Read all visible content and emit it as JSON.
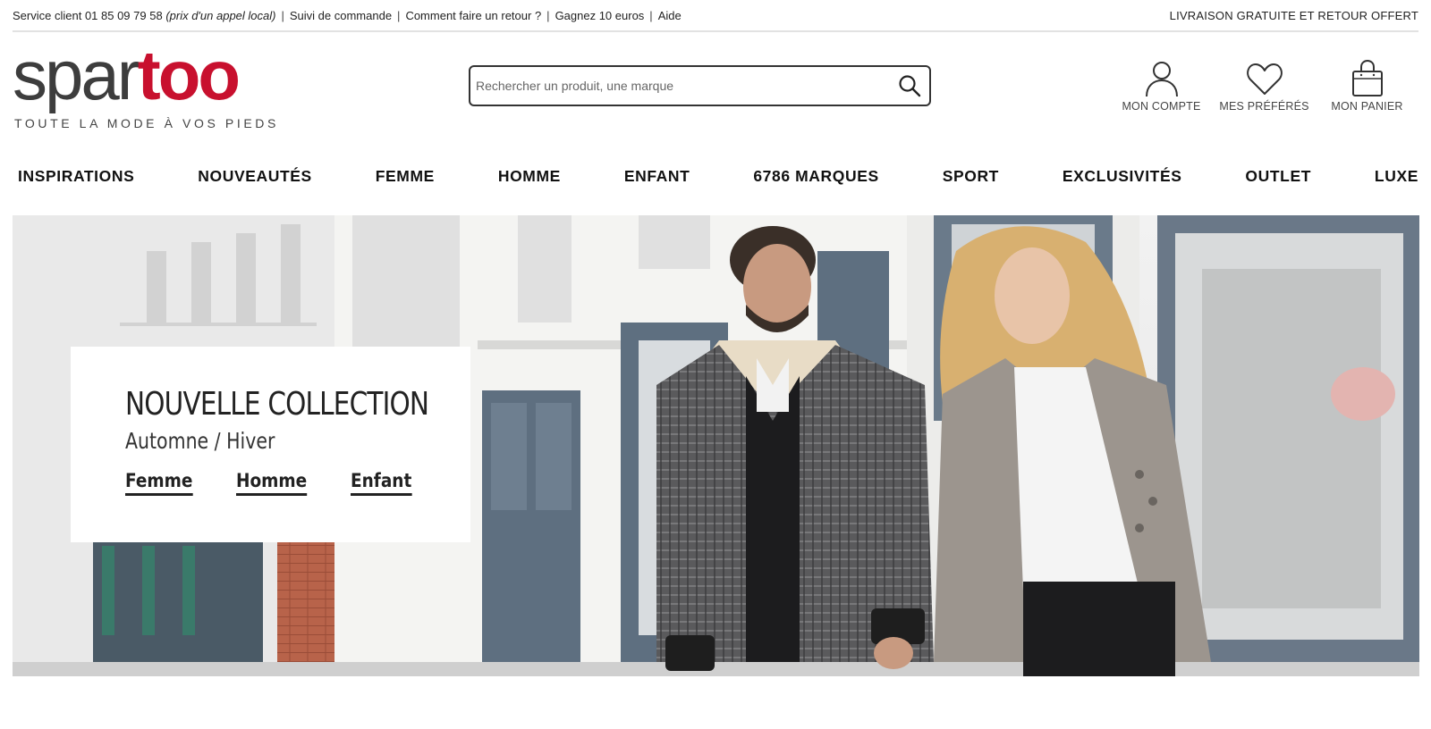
{
  "topbar": {
    "service_label": "Service client",
    "phone": "01 85 09 79 58",
    "phone_note": "(prix d'un appel local)",
    "links": [
      "Suivi de commande",
      "Comment faire un retour ?",
      "Gagnez 10 euros",
      "Aide"
    ],
    "promo_right": "LIVRAISON GRATUITE ET RETOUR OFFERT"
  },
  "header": {
    "logo_part1": "spar",
    "logo_part2": "too",
    "tagline": "TOUTE LA MODE À VOS PIEDS",
    "search_placeholder": "Rechercher un produit, une marque",
    "account_label": "MON COMPTE",
    "favorites_label": "MES PRÉFÉRÉS",
    "cart_label": "MON PANIER"
  },
  "nav": {
    "items": [
      "INSPIRATIONS",
      "NOUVEAUTÉS",
      "FEMME",
      "HOMME",
      "ENFANT",
      "6786 MARQUES",
      "SPORT",
      "EXCLUSIVITÉS",
      "OUTLET",
      "LUXE"
    ]
  },
  "hero": {
    "title": "NOUVELLE COLLECTION",
    "subtitle": "Automne / Hiver",
    "links": [
      "Femme",
      "Homme",
      "Enfant"
    ]
  },
  "colors": {
    "brand_red": "#c8102e",
    "logo_gray": "#3d3d3d",
    "text_dark": "#222222"
  }
}
